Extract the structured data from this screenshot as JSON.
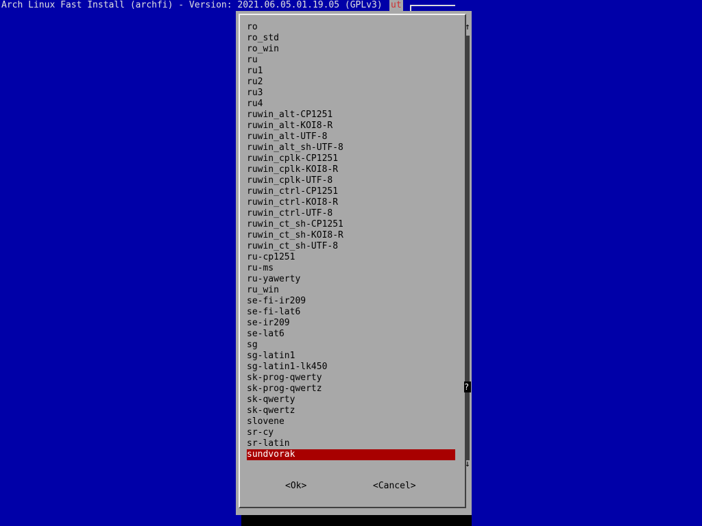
{
  "header": {
    "title": "Arch Linux Fast Install (archfi) - Version: 2021.06.05.01.19.05 (GPLv3)",
    "partial_text": "ut"
  },
  "list": {
    "items": [
      "ro",
      "ro_std",
      "ro_win",
      "ru",
      "ru1",
      "ru2",
      "ru3",
      "ru4",
      "ruwin_alt-CP1251",
      "ruwin_alt-KOI8-R",
      "ruwin_alt-UTF-8",
      "ruwin_alt_sh-UTF-8",
      "ruwin_cplk-CP1251",
      "ruwin_cplk-KOI8-R",
      "ruwin_cplk-UTF-8",
      "ruwin_ctrl-CP1251",
      "ruwin_ctrl-KOI8-R",
      "ruwin_ctrl-UTF-8",
      "ruwin_ct_sh-CP1251",
      "ruwin_ct_sh-KOI8-R",
      "ruwin_ct_sh-UTF-8",
      "ru-cp1251",
      "ru-ms",
      "ru-yawerty",
      "ru_win",
      "se-fi-ir209",
      "se-fi-lat6",
      "se-ir209",
      "se-lat6",
      "sg",
      "sg-latin1",
      "sg-latin1-lk450",
      "sk-prog-qwerty",
      "sk-prog-qwertz",
      "sk-qwerty",
      "sk-qwertz",
      "slovene",
      "sr-cy",
      "sr-latin",
      "sundvorak"
    ],
    "selected": "sundvorak"
  },
  "scrollbar": {
    "up_icon": "↑",
    "down_icon": "↓",
    "thumb": "?"
  },
  "buttons": {
    "ok": "<Ok>",
    "cancel": "<Cancel>"
  }
}
